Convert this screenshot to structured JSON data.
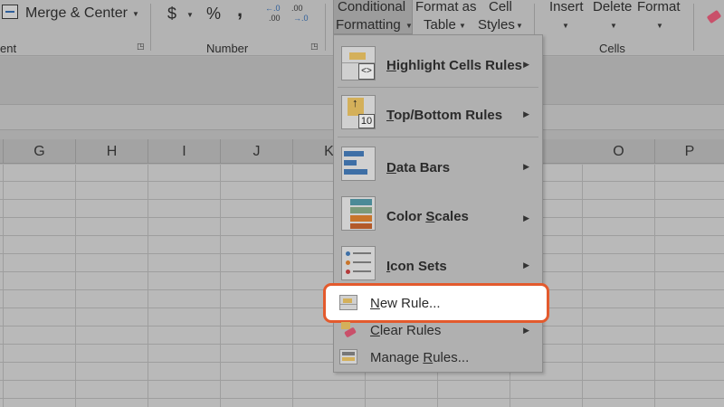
{
  "ribbon": {
    "partial_group_label": "ent",
    "merge_center": "Merge & Center",
    "currency_symbol": "$",
    "percent_symbol": "%",
    "comma_symbol": ",",
    "inc_decimal_top": "←.0",
    "inc_decimal_bottom": ".00",
    "dec_decimal_top": ".00",
    "dec_decimal_bottom": "→.0",
    "number_group": "Number",
    "cf_line1": "Conditional",
    "cf_line2": "Formatting",
    "fat_line1": "Format as",
    "fat_line2": "Table",
    "cs_line1": "Cell",
    "cs_line2": "Styles",
    "insert": "Insert",
    "delete": "Delete",
    "format": "Format",
    "cells_group": "Cells"
  },
  "columns": [
    "G",
    "H",
    "I",
    "J",
    "K",
    "O",
    "P"
  ],
  "menu": {
    "highlight_cells": {
      "pre": "",
      "key": "H",
      "post": "ighlight Cells Rules"
    },
    "top_bottom": {
      "pre": "",
      "key": "T",
      "post": "op/Bottom Rules"
    },
    "top_bottom_badge": "10",
    "highlight_badge": "<>",
    "data_bars": {
      "pre": "",
      "key": "D",
      "post": "ata Bars"
    },
    "color_scales": {
      "pre": "Color ",
      "key": "S",
      "post": "cales"
    },
    "icon_sets": {
      "pre": "",
      "key": "I",
      "post": "con Sets"
    },
    "new_rule": {
      "pre": "",
      "key": "N",
      "post": "ew Rule..."
    },
    "clear_rules": {
      "pre": "",
      "key": "C",
      "post": "lear Rules"
    },
    "manage_rules": {
      "pre": "Manage ",
      "key": "R",
      "post": "ules..."
    }
  },
  "colors": {
    "highlight_border": "#e35a2d",
    "data_bar_blue": "#3e6fa6",
    "scale_orange": "#c8752b",
    "scale_teal": "#4b8a97",
    "rule_yellow": "#d4b05a"
  }
}
